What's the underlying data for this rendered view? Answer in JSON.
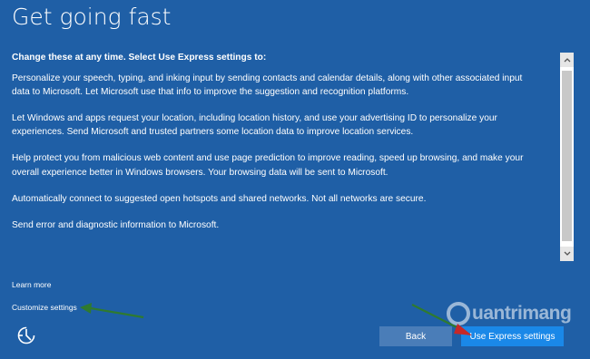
{
  "page": {
    "title": "Get going fast",
    "intro": "Change these at any time. Select Use Express settings to:",
    "paragraphs": [
      "Personalize your speech, typing, and inking input by sending contacts and calendar details, along with other associated input data to Microsoft. Let Microsoft use that info to improve the suggestion and recognition platforms.",
      "Let Windows and apps request your location, including location history, and use your advertising ID to personalize your experiences. Send Microsoft and trusted partners some location data to improve location services.",
      "Help protect you from malicious web content and use page prediction to improve reading, speed up browsing, and make your overall experience better in Windows browsers. Your browsing data will be sent to Microsoft.",
      "Automatically connect to suggested open hotspots and shared networks. Not all networks are secure.",
      "Send error and diagnostic information to Microsoft."
    ]
  },
  "links": {
    "learn_more": "Learn more",
    "customize": "Customize settings"
  },
  "buttons": {
    "back": "Back",
    "express": "Use Express settings"
  },
  "icons": {
    "ease_of_access": "ease-of-access-icon",
    "scroll_up": "chevron-up-icon",
    "scroll_down": "chevron-down-icon"
  },
  "watermark": {
    "text": "uantrimang"
  },
  "colors": {
    "background": "#1f5fa6",
    "back_button": "#4a7db8",
    "express_button": "#1a88e8",
    "annotation_arrow": "#2f7a2f",
    "annotation_arrow_tip": "#c62828"
  }
}
